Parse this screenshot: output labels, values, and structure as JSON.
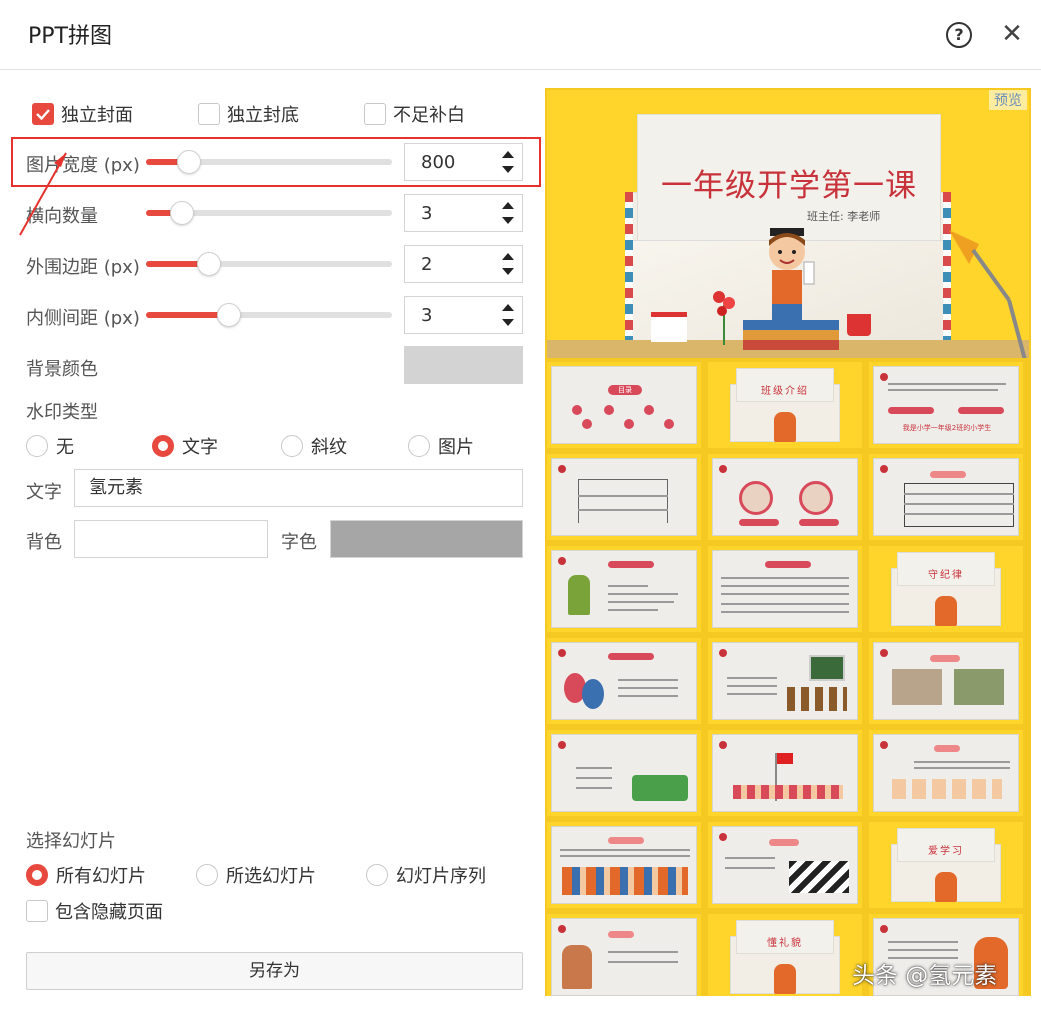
{
  "window": {
    "title": "PPT拼图",
    "help_label": "?",
    "close_label": "✕"
  },
  "options": {
    "cover_label": "独立封面",
    "cover_checked": true,
    "backcover_label": "独立封底",
    "backcover_checked": false,
    "fill_label": "不足补白",
    "fill_checked": false
  },
  "settings": [
    {
      "label": "图片宽度 (px)",
      "value": "800",
      "level": 0.14
    },
    {
      "label": "横向数量",
      "value": "3",
      "level": 0.11
    },
    {
      "label": "外围边距 (px)",
      "value": "2",
      "level": 0.23
    },
    {
      "label": "内侧间距 (px)",
      "value": "3",
      "level": 0.32
    }
  ],
  "background": {
    "label": "背景颜色",
    "color": "#d3d3d3"
  },
  "watermark_type": {
    "label": "水印类型",
    "options": [
      "无",
      "文字",
      "斜纹",
      "图片"
    ],
    "selected": "文字"
  },
  "watermark_text": {
    "label": "文字",
    "value": "氢元素"
  },
  "watermark_colors": {
    "bg_label": "背色",
    "bg_color": "#ffffff",
    "fg_label": "字色",
    "fg_color": "#a6a6a6"
  },
  "slide_select": {
    "label": "选择幻灯片",
    "options": [
      "所有幻灯片",
      "所选幻灯片",
      "幻灯片序列"
    ],
    "selected": "所有幻灯片",
    "hidden_label": "包含隐藏页面",
    "hidden_checked": false
  },
  "save_label": "另存为",
  "preview": {
    "badge": "预览",
    "cover_title": "一年级开学第一课",
    "cover_subtitle": "班主任: 李老师",
    "thumb_labels": {
      "t2": "班级介绍",
      "t3": "我是小学一年级2班的小学生",
      "t9": "守纪律",
      "t20": "爱学习",
      "t23": "懂礼貌",
      "t1": "目录"
    }
  },
  "overlay_watermark": "头条 @氢元素",
  "colors": {
    "accent": "#e8493f",
    "highlight": "#e5322d",
    "preview_bg": "#f5c921"
  }
}
